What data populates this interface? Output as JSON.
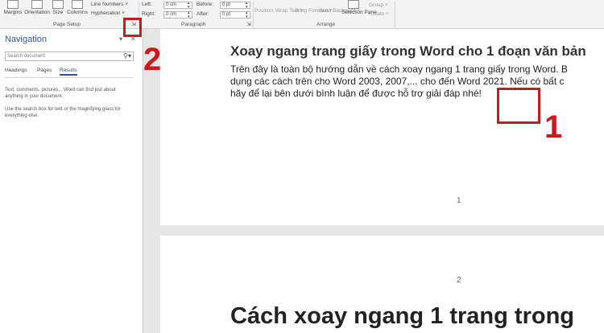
{
  "ribbon": {
    "margins": "Margins",
    "orientation": "Orientation",
    "size": "Size",
    "columns": "Columns",
    "line_numbers": "Line Numbers ˅",
    "hyphenation": "Hyphenation ˅",
    "page_setup_group": "Page Setup",
    "indent_left_label": "Left:",
    "indent_left_value": "0 cm",
    "indent_right_label": "Right:",
    "indent_right_value": "0 cm",
    "spacing_before_label": "Before:",
    "spacing_before_value": "0 pt",
    "spacing_after_label": "After:",
    "spacing_after_value": "0 pt",
    "paragraph_group": "Paragraph",
    "position": "Position",
    "wrap_text": "Wrap Text ˅",
    "bring_forward": "Bring Forward ˅",
    "send_backward": "Send Backward ˅",
    "selection_pane": "Selection Pane",
    "group": "Group ˅",
    "rotate": "Rotate ˅",
    "arrange_group": "Arrange"
  },
  "nav": {
    "title": "Navigation",
    "search_placeholder": "Search document",
    "tabs": [
      "Headings",
      "Pages",
      "Results"
    ],
    "message_1": "Text, comments, pictures... Word can find just about anything in your document.",
    "message_2": "Use the search box for text or the magnifying glass for everything else."
  },
  "document": {
    "heading": "Xoay ngang trang giấy trong Word cho 1 đoạn văn bản",
    "para_lines": [
      "Trên đây là toàn bộ hướng dẫn về cách xoay ngang 1 trang giấy trong Word. B",
      "dụng các cách trên cho Word 2003, 2007,... cho đến Word 2021. Nếu có bất c",
      "hãy để lại bên dưới bình luận để được hỗ trợ giải đáp nhé!"
    ],
    "page_number_1": "1",
    "page_number_2": "2",
    "page2_title": "Cách xoay ngang 1 trang trong"
  },
  "annotations": {
    "label_1": "1",
    "label_2": "2",
    "color": "#c81c1c"
  }
}
